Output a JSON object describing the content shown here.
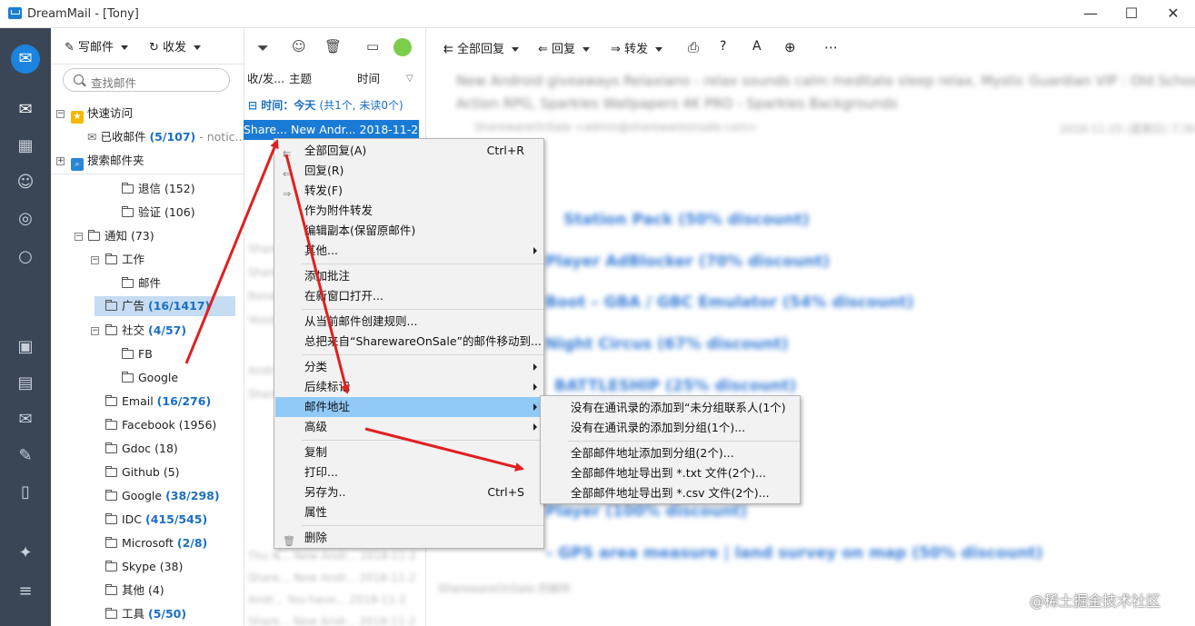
{
  "window": {
    "title": "DreamMail - [Tony]",
    "minimize": "—",
    "maximize": "☐",
    "close": "✕"
  },
  "toolbar": {
    "compose": "写邮件",
    "send_receive": "收发"
  },
  "search": {
    "placeholder": "查找邮件"
  },
  "tree": {
    "quick_access": "快速访问",
    "received": "已收邮件",
    "received_count": "(5/107)",
    "received_suffix": "- notic...",
    "search_folder": "搜索邮件夹",
    "items": [
      {
        "label": "退信 (152)",
        "count": ""
      },
      {
        "label": "验证 (106)",
        "count": ""
      },
      {
        "label": "通知 (73)",
        "count": ""
      },
      {
        "label": "工作",
        "count": ""
      },
      {
        "label": "邮件",
        "count": ""
      },
      {
        "label": "广告",
        "count": "(16/1417)"
      },
      {
        "label": "社交",
        "count": "(4/57)"
      },
      {
        "label": "FB",
        "count": ""
      },
      {
        "label": "Google",
        "count": ""
      },
      {
        "label": "Email",
        "count": "(16/276)"
      },
      {
        "label": "Facebook (1956)",
        "count": ""
      },
      {
        "label": "Gdoc (18)",
        "count": ""
      },
      {
        "label": "Github (5)",
        "count": ""
      },
      {
        "label": "Google",
        "count": "(38/298)"
      },
      {
        "label": "IDC",
        "count": "(415/545)"
      },
      {
        "label": "Microsoft",
        "count": "(2/8)"
      },
      {
        "label": "Skype (38)",
        "count": ""
      },
      {
        "label": "其他 (4)",
        "count": ""
      },
      {
        "label": "工具",
        "count": "(5/50)"
      }
    ]
  },
  "list": {
    "col_folder": "收/发...",
    "col_subject": "主题",
    "col_time": "时间",
    "group_today": "时间：今天",
    "group_stats": "(共1个, 未读0个)",
    "selected_row": "Share... New Andr... 2018-11-2..."
  },
  "reader_toolbar": {
    "reply_all": "全部回复",
    "reply": "回复",
    "forward": "转发"
  },
  "reader": {
    "subject_line1": "New Android giveaways Relaxiano - relax sounds calm meditate sleep relax, Mystic Guardian VIP : Old School",
    "subject_line2": "Action RPG, Sparkles Wallpapers 4K PRO - Sparkles Backgrounds",
    "from_line": "SharewareOnSale <admin@sharewareonsale.com>",
    "date": "2018-11-25 (星期日) 7:36"
  },
  "context_menu": {
    "items": [
      {
        "label": "全部回复(A)",
        "shortcut": "Ctrl+R",
        "icon": "reply-all-icon"
      },
      {
        "label": "回复(R)",
        "shortcut": "",
        "icon": "reply-icon"
      },
      {
        "label": "转发(F)",
        "shortcut": "",
        "icon": "forward-icon"
      },
      {
        "label": "作为附件转发",
        "shortcut": ""
      },
      {
        "label": "编辑副本(保留原邮件)",
        "shortcut": ""
      },
      {
        "label": "其他...",
        "shortcut": ""
      },
      {
        "label": "添加批注",
        "shortcut": ""
      },
      {
        "label": "在新窗口打开...",
        "shortcut": ""
      },
      {
        "label": "从当前邮件创建规则...",
        "shortcut": ""
      },
      {
        "label": "总把来自“SharewareOnSale”的邮件移动到...",
        "shortcut": ""
      },
      {
        "label": "分类",
        "shortcut": ""
      },
      {
        "label": "后续标记",
        "shortcut": ""
      },
      {
        "label": "邮件地址",
        "shortcut": ""
      },
      {
        "label": "高级",
        "shortcut": ""
      },
      {
        "label": "复制",
        "shortcut": ""
      },
      {
        "label": "打印...",
        "shortcut": ""
      },
      {
        "label": "另存为..",
        "shortcut": "Ctrl+S"
      },
      {
        "label": "属性",
        "shortcut": ""
      },
      {
        "label": "删除",
        "shortcut": ""
      }
    ]
  },
  "submenu": {
    "items": [
      "没有在通讯录的添加到“未分组联系人(1个)",
      "没有在通讯录的添加到分组(1个)...",
      "全部邮件地址添加到分组(2个)...",
      "全部邮件地址导出到 *.txt 文件(2个)...",
      "全部邮件地址导出到 *.csv 文件(2个)..."
    ]
  },
  "watermark": "@稀土掘金技术社区",
  "colors": {
    "accent": "#1a7bd6",
    "sidebar": "#3a4656",
    "highlight": "#91c9f7",
    "arrow": "#e02020"
  }
}
